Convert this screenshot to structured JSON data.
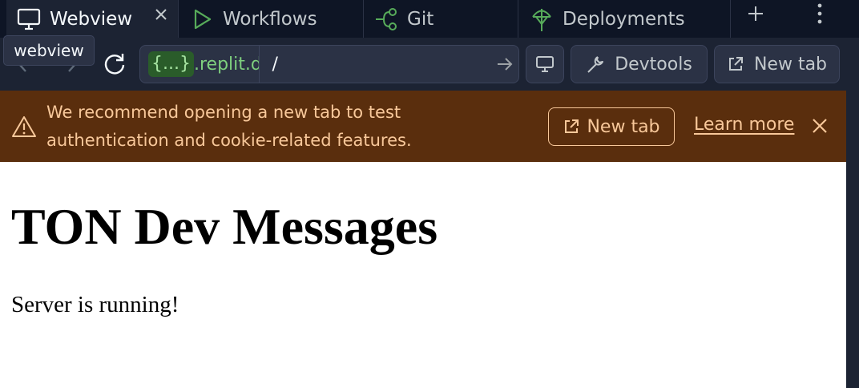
{
  "tabs": [
    {
      "label": "Webview",
      "icon": "monitor-icon"
    },
    {
      "label": "Workflows",
      "icon": "play-icon"
    },
    {
      "label": "Git",
      "icon": "git-branch-icon"
    },
    {
      "label": "Deployments",
      "icon": "deploy-icon"
    }
  ],
  "tooltip": "webview",
  "url": {
    "domain_badge": "{...}",
    "domain_suffix": ".replit.dev",
    "path": "/"
  },
  "toolbar": {
    "devtools_label": "Devtools",
    "newtab_label": "New tab"
  },
  "banner": {
    "message": "We recommend opening a new tab to test authentication and cookie-related features.",
    "newtab_label": "New tab",
    "learn_more_label": "Learn more"
  },
  "page": {
    "heading": "TON Dev Messages",
    "body": "Server is running!"
  },
  "colors": {
    "tab_bar_bg": "#0e1525",
    "toolbar_bg": "#1c2333",
    "banner_bg": "#5a2e0d",
    "banner_text": "#f8c89a",
    "domain_green": "#7ecf7e"
  }
}
